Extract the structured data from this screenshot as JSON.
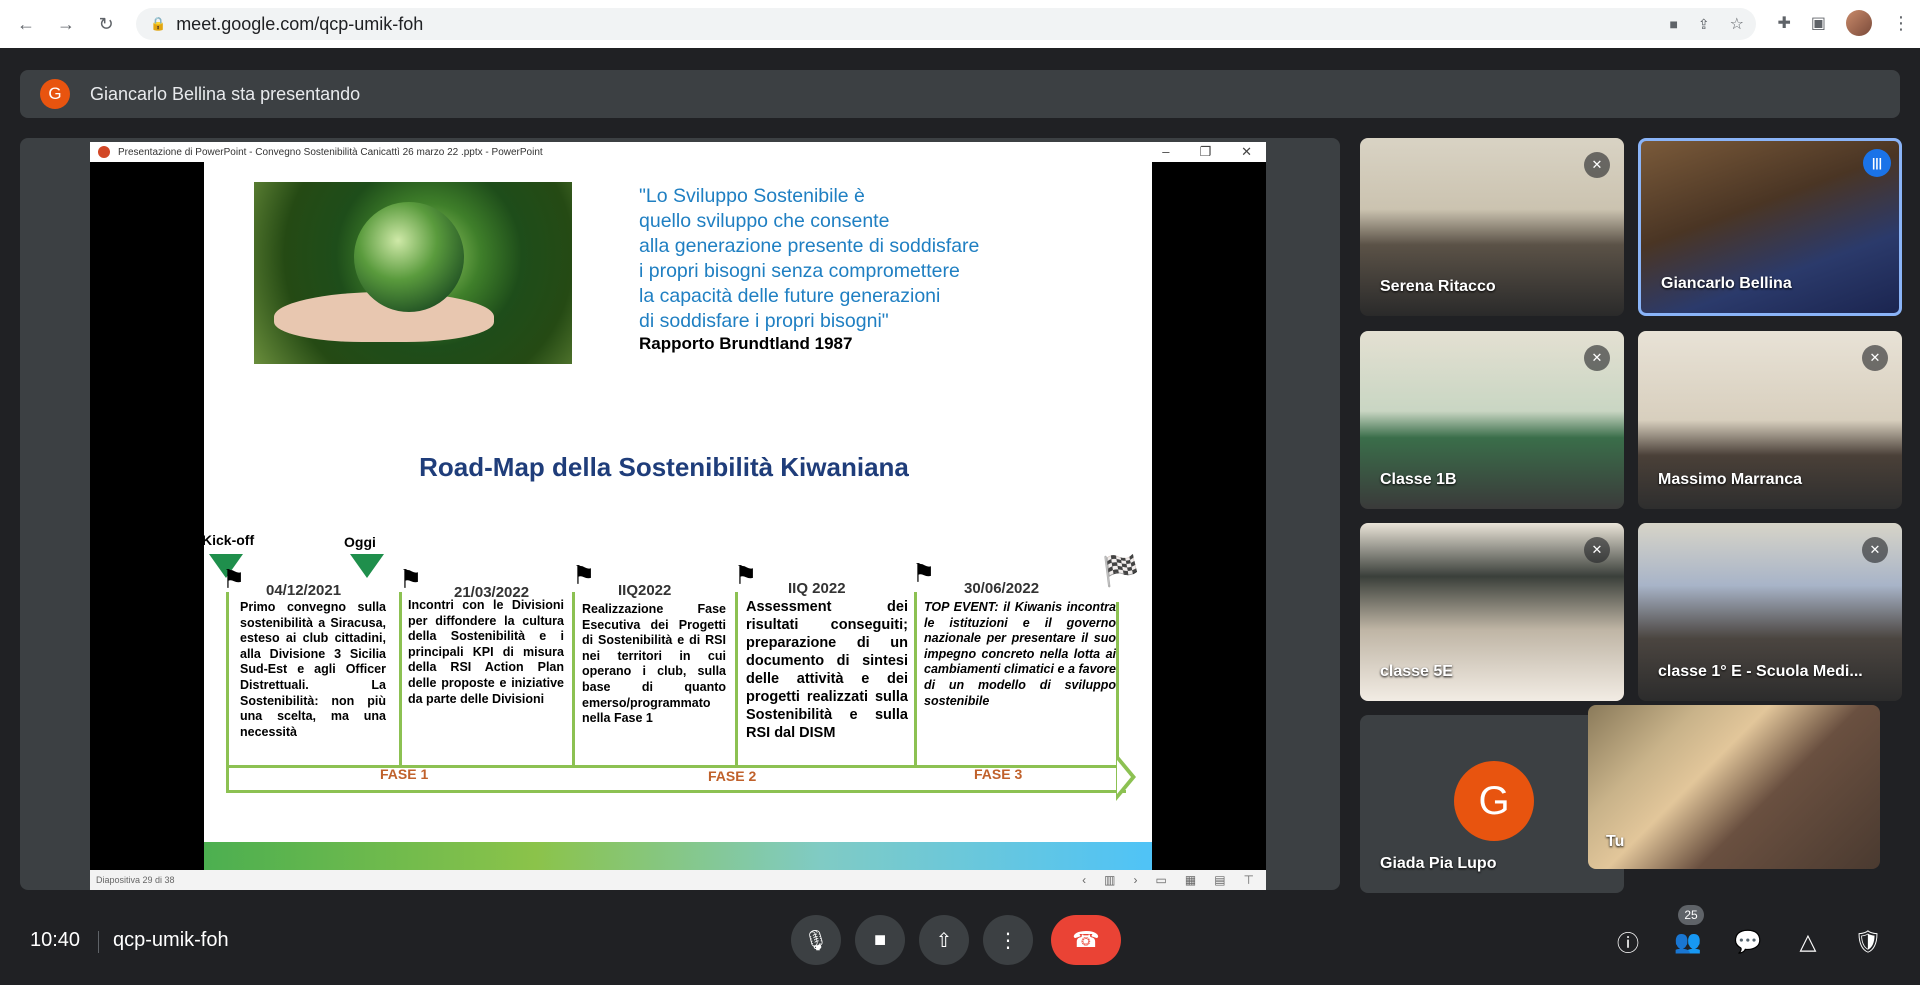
{
  "browser": {
    "url": "meet.google.com/qcp-umik-foh"
  },
  "banner": {
    "avatar_letter": "G",
    "text": "Giancarlo Bellina sta presentando"
  },
  "powerpoint": {
    "window_title": "Presentazione di PowerPoint  -  Convegno Sostenibilità  Canicattì 26 marzo 22 .pptx - PowerPoint",
    "status": "Diapositiva 29 di 38"
  },
  "slide": {
    "quote_lines": [
      "\"Lo Sviluppo Sostenibile è",
      "quello sviluppo che consente",
      "alla generazione presente di soddisfare",
      "i propri bisogni senza compromettere",
      "la capacità delle future generazioni",
      "di soddisfare i propri bisogni\""
    ],
    "quote_author": "Rapporto Brundtland 1987",
    "roadmap_title": "Road-Map della Sostenibilità Kiwaniana",
    "kickoff_label": "Kick-off",
    "oggi_label": "Oggi",
    "milestones": [
      {
        "date": "04/12/2021",
        "text": "Primo convegno sulla sostenibilità a Siracusa, esteso ai club cittadini, alla Divisione 3 Sicilia Sud-Est e agli Officer Distrettuali. La Sostenibilità: non più una scelta, ma una necessità"
      },
      {
        "date": "21/03/2022",
        "text": "Incontri con le Divisioni per diffondere la cultura della Sostenibilità e i principali KPI di misura della RSI Action Plan delle proposte e iniziative da parte delle Divisioni"
      },
      {
        "date": "IIQ2022",
        "text": "Realizzazione Fase Esecutiva dei Progetti di Sostenibilità e di RSI nei territori in cui operano i club, sulla base di quanto emerso/programmato nella Fase 1"
      },
      {
        "date": "IIQ 2022",
        "text": "Assessment dei risultati conseguiti; preparazione di un documento di sintesi delle attività e dei progetti realizzati sulla Sostenibilità e sulla RSI dal DISM"
      },
      {
        "date": "30/06/2022",
        "text": "TOP EVENT: il Kiwanis incontra le istituzioni e il governo nazionale per presentare il suo impegno concreto nella lotta ai cambiamenti climatici e a favore di un modello di sviluppo sostenibile"
      }
    ],
    "phases": [
      "FASE 1",
      "FASE 2",
      "FASE 3"
    ]
  },
  "participants": [
    {
      "name": "Serena Ritacco",
      "muted": true
    },
    {
      "name": "Giancarlo Bellina",
      "muted": false,
      "speaking": true
    },
    {
      "name": "Classe 1B",
      "muted": true
    },
    {
      "name": "Massimo Marranca",
      "muted": true
    },
    {
      "name": "classe 5E",
      "muted": true
    },
    {
      "name": "classe 1° E - Scuola Medi...",
      "muted": true
    },
    {
      "name": "Giada Pia Lupo",
      "avatar_letter": "G"
    }
  ],
  "self_view": {
    "name": "Tu"
  },
  "bottom_bar": {
    "time": "10:40",
    "meeting_code": "qcp-umik-foh",
    "participant_count": "25"
  },
  "colors": {
    "accent": "#1a73e8",
    "end_call": "#ea4335",
    "avatar": "#e8540f",
    "slide_title": "#1f3d7a",
    "quote": "#1f7fc2",
    "timeline_green": "#8cc152",
    "phase": "#c0612b"
  }
}
